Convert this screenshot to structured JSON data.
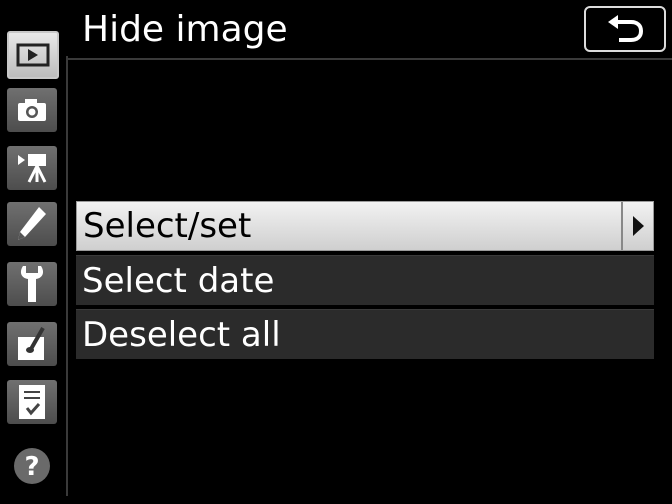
{
  "header": {
    "title": "Hide image"
  },
  "sidebar": {
    "tabs": [
      {
        "icon": "playback-icon",
        "active": true
      },
      {
        "icon": "camera-icon",
        "active": false
      },
      {
        "icon": "movie-camera-icon",
        "active": false
      },
      {
        "icon": "pencil-icon",
        "active": false
      },
      {
        "icon": "wrench-icon",
        "active": false
      },
      {
        "icon": "retouch-brush-icon",
        "active": false
      },
      {
        "icon": "my-menu-icon",
        "active": false
      },
      {
        "icon": "help-icon",
        "active": false
      }
    ]
  },
  "menu": {
    "items": [
      {
        "label": "Select/set",
        "selected": true
      },
      {
        "label": "Select date",
        "selected": false
      },
      {
        "label": "Deselect all",
        "selected": false
      }
    ]
  },
  "colors": {
    "background": "#000000",
    "selected_row": "#e0e0e0",
    "normal_row": "#2b2b2b"
  }
}
